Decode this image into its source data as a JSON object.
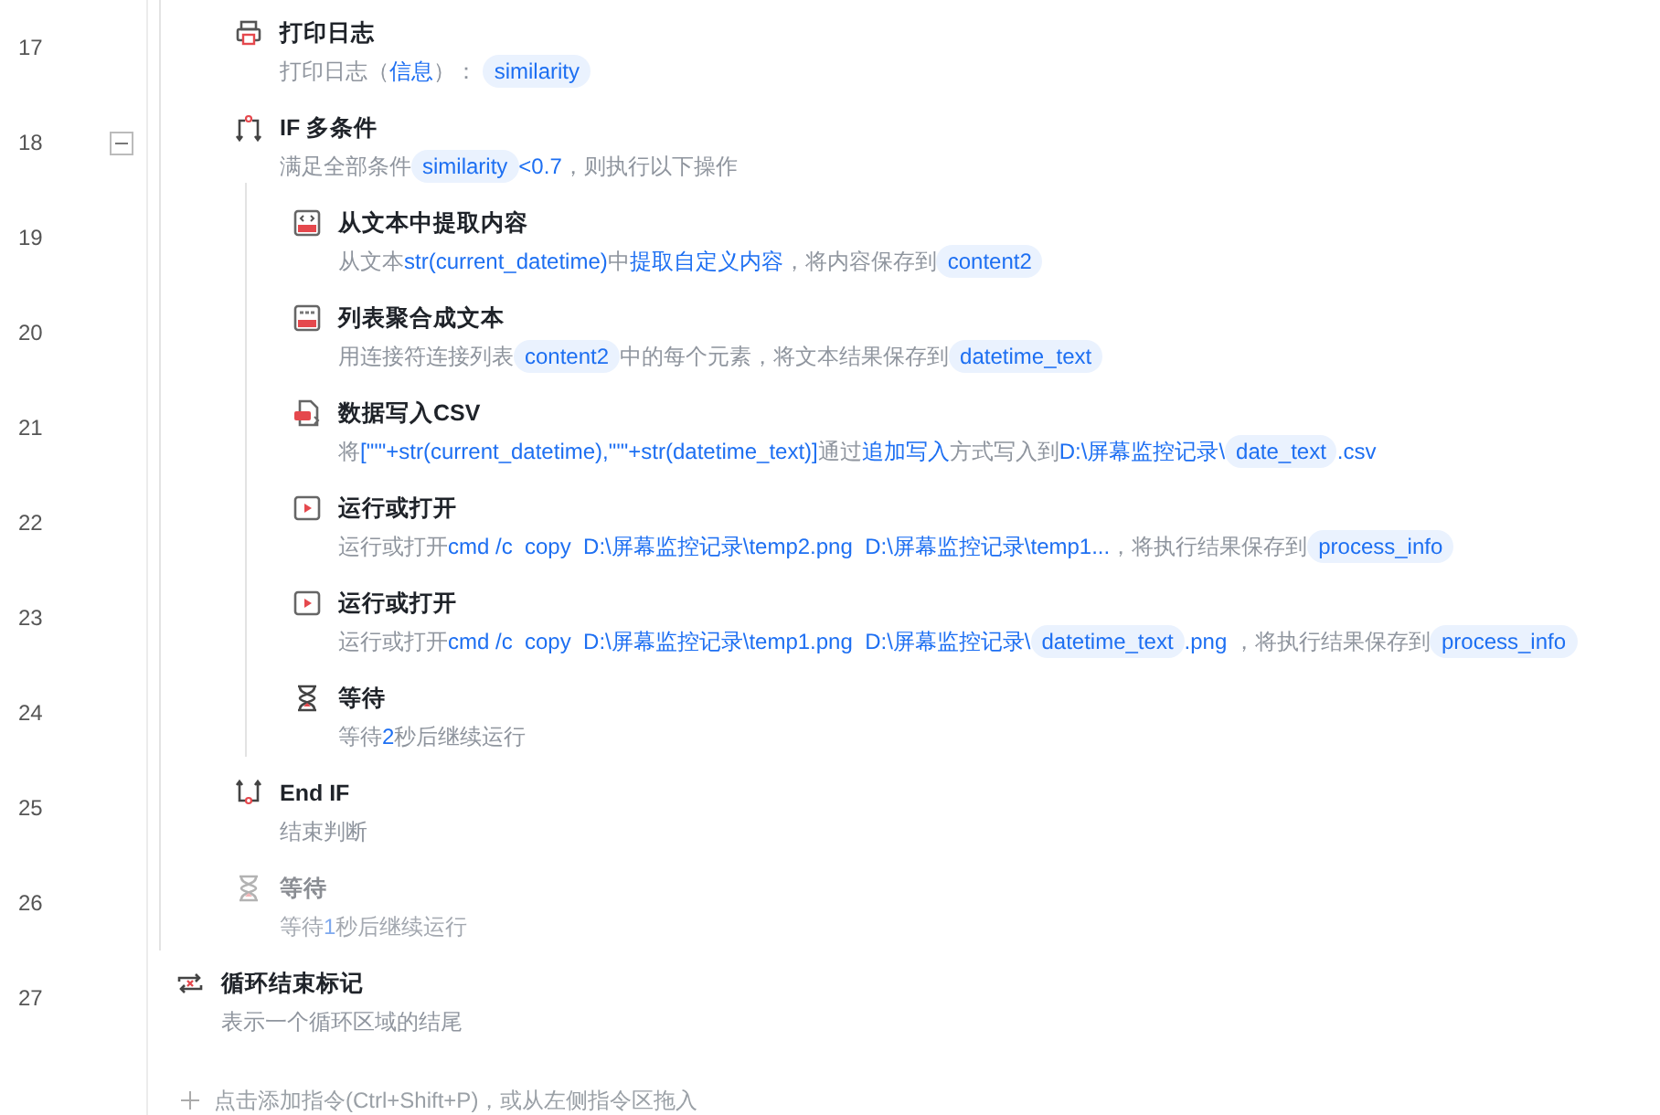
{
  "loop_body": [
    {
      "line": "17",
      "kind": "print",
      "title": "打印日志",
      "disabled": false,
      "desc": [
        {
          "kind": "text",
          "text": "打印日志（"
        },
        {
          "kind": "link",
          "text": "信息"
        },
        {
          "kind": "text",
          "text": "）： "
        },
        {
          "kind": "var",
          "text": "similarity"
        }
      ]
    },
    {
      "line": "18",
      "kind": "if",
      "title": "IF 多条件",
      "disabled": false,
      "expanded": true,
      "desc": [
        {
          "kind": "text",
          "text": "满足全部条件"
        },
        {
          "kind": "var",
          "text": "similarity"
        },
        {
          "kind": "link",
          "text": "<0.7"
        },
        {
          "kind": "text",
          "text": "，则执行以下操作"
        }
      ],
      "children": [
        {
          "line": "19",
          "kind": "extract",
          "title": "从文本中提取内容",
          "disabled": false,
          "desc": [
            {
              "kind": "text",
              "text": "从文本"
            },
            {
              "kind": "link",
              "text": "str(current_datetime)"
            },
            {
              "kind": "text",
              "text": "中"
            },
            {
              "kind": "link",
              "text": "提取自定义内容"
            },
            {
              "kind": "text",
              "text": "，将内容保存到"
            },
            {
              "kind": "var",
              "text": "content2"
            }
          ]
        },
        {
          "line": "20",
          "kind": "join",
          "title": "列表聚合成文本",
          "disabled": false,
          "desc": [
            {
              "kind": "text",
              "text": "用连接符连接列表"
            },
            {
              "kind": "var",
              "text": "content2"
            },
            {
              "kind": "text",
              "text": "中的每个元素，将文本结果保存到"
            },
            {
              "kind": "var",
              "text": "datetime_text"
            }
          ]
        },
        {
          "line": "21",
          "kind": "csv",
          "title": "数据写入CSV",
          "disabled": false,
          "desc": [
            {
              "kind": "text",
              "text": "将"
            },
            {
              "kind": "link",
              "text": "[\"'\"+str(current_datetime),\"'\"+str(datetime_text)]"
            },
            {
              "kind": "text",
              "text": "通过"
            },
            {
              "kind": "link",
              "text": "追加写入"
            },
            {
              "kind": "text",
              "text": "方式写入到"
            },
            {
              "kind": "link",
              "text": "D:\\屏幕监控记录\\"
            },
            {
              "kind": "var",
              "text": "date_text"
            },
            {
              "kind": "link",
              "text": ".csv"
            }
          ]
        },
        {
          "line": "22",
          "kind": "run",
          "title": "运行或打开",
          "disabled": false,
          "desc": [
            {
              "kind": "text",
              "text": "运行或打开"
            },
            {
              "kind": "link",
              "text": "cmd /c  copy  D:\\屏幕监控记录\\temp2.png  D:\\屏幕监控记录\\temp1..."
            },
            {
              "kind": "text",
              "text": "，将执行结果保存到"
            },
            {
              "kind": "var",
              "text": "process_info"
            }
          ]
        },
        {
          "line": "23",
          "kind": "run",
          "title": "运行或打开",
          "disabled": false,
          "desc": [
            {
              "kind": "text",
              "text": "运行或打开"
            },
            {
              "kind": "link",
              "text": "cmd /c  copy  D:\\屏幕监控记录\\temp1.png  D:\\屏幕监控记录\\"
            },
            {
              "kind": "var",
              "text": "datetime_text"
            },
            {
              "kind": "link",
              "text": ".png"
            },
            {
              "kind": "text",
              "text": " ，将执行结果保存到"
            },
            {
              "kind": "var",
              "text": "process_info"
            }
          ]
        },
        {
          "line": "24",
          "kind": "wait",
          "title": "等待",
          "disabled": false,
          "desc": [
            {
              "kind": "text",
              "text": "等待"
            },
            {
              "kind": "link",
              "text": "2"
            },
            {
              "kind": "text",
              "text": "秒后继续运行"
            }
          ]
        }
      ]
    },
    {
      "line": "25",
      "kind": "endif",
      "title": "End IF",
      "disabled": false,
      "desc": [
        {
          "kind": "text",
          "text": "结束判断"
        }
      ]
    },
    {
      "line": "26",
      "kind": "wait",
      "title": "等待",
      "disabled": true,
      "desc": [
        {
          "kind": "text",
          "text": "等待"
        },
        {
          "kind": "link",
          "text": "1"
        },
        {
          "kind": "text",
          "text": "秒后继续运行"
        }
      ]
    }
  ],
  "after_loop": [
    {
      "line": "27",
      "kind": "loopend",
      "title": "循环结束标记",
      "disabled": false,
      "desc": [
        {
          "kind": "text",
          "text": "表示一个循环区域的结尾"
        }
      ]
    }
  ],
  "add_hint": "点击添加指令(Ctrl+Shift+P)，或从左侧指令区拖入"
}
